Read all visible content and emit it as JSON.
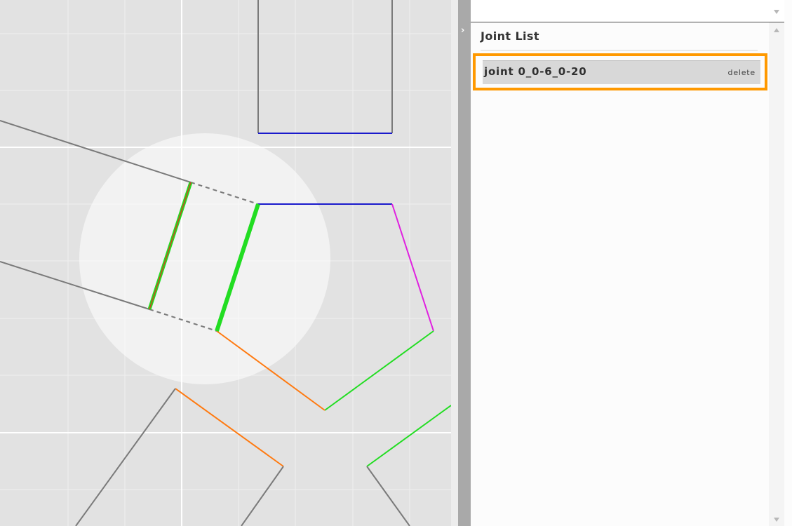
{
  "sidebar": {
    "collapse_glyph": "›",
    "title": "Joint List",
    "joints": [
      {
        "label": "joint 0_0-6_0-20",
        "delete_label": "delete"
      }
    ]
  },
  "colors": {
    "grid_line": "#f6f6f6",
    "piece_outline": "#7a7a7a",
    "edge_blue": "#1a1acc",
    "edge_magenta": "#e020e0",
    "edge_green": "#22dd22",
    "edge_orange": "#ff7a10",
    "joint_red": "#d04020",
    "highlight": "#ff9900"
  },
  "icons": [
    "chevron-right-icon",
    "scroll-up-icon",
    "scroll-down-icon"
  ]
}
